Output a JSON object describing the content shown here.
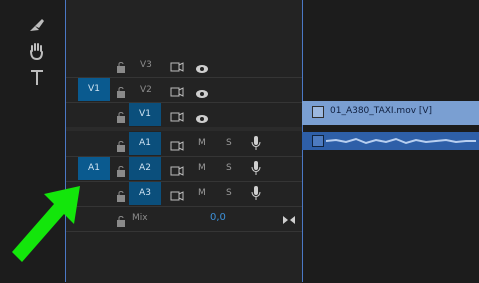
{
  "tracks": {
    "video": [
      {
        "name": "V3",
        "source": "",
        "targeted": false
      },
      {
        "name": "V2",
        "source": "V1",
        "targeted": false
      },
      {
        "name": "V1",
        "source": "",
        "targeted": true
      }
    ],
    "audio": [
      {
        "name": "A1",
        "source": "",
        "targeted": true,
        "m": "M",
        "s": "S"
      },
      {
        "name": "A2",
        "source": "A1",
        "targeted": true,
        "m": "M",
        "s": "S"
      },
      {
        "name": "A3",
        "source": "",
        "targeted": true,
        "m": "M",
        "s": "S"
      }
    ],
    "mix": {
      "label": "Mix",
      "value": "0,0"
    }
  },
  "clips": {
    "video_clip_label": "01_A380_TAXI.mov [V]"
  },
  "colors": {
    "target_blue": "#0b4f7c",
    "clip_video": "#7a9fd2",
    "clip_audio": "#2e5fa8",
    "arrow": "#13e60b"
  }
}
